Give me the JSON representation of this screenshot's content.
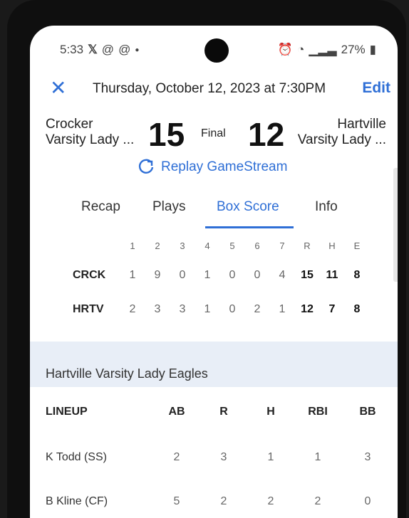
{
  "status_bar": {
    "time": "5:33",
    "left_icons": [
      "x-logo-icon",
      "threads-icon",
      "threads-icon",
      "dot-icon"
    ],
    "battery": "27%"
  },
  "header": {
    "close_label": "✕",
    "date": "Thursday, October 12, 2023 at 7:30PM",
    "edit_label": "Edit"
  },
  "game": {
    "home_team_line1": "Crocker",
    "home_team_line2": "Varsity Lady ...",
    "home_score": "15",
    "status": "Final",
    "away_score": "12",
    "away_team_line1": "Hartville",
    "away_team_line2": "Varsity Lady ...",
    "replay_label": "Replay GameStream"
  },
  "tabs": [
    {
      "label": "Recap",
      "active": false
    },
    {
      "label": "Plays",
      "active": false
    },
    {
      "label": "Box Score",
      "active": true
    },
    {
      "label": "Info",
      "active": false
    }
  ],
  "linescore": {
    "headers": [
      "1",
      "2",
      "3",
      "4",
      "5",
      "6",
      "7",
      "R",
      "H",
      "E"
    ],
    "rows": [
      {
        "team": "CRCK",
        "innings": [
          "1",
          "9",
          "0",
          "1",
          "0",
          "0",
          "4"
        ],
        "R": "15",
        "H": "11",
        "E": "8"
      },
      {
        "team": "HRTV",
        "innings": [
          "2",
          "3",
          "3",
          "1",
          "0",
          "2",
          "1"
        ],
        "R": "12",
        "H": "7",
        "E": "8"
      }
    ]
  },
  "section_title": "Hartville Varsity Lady Eagles",
  "lineup": {
    "headers": [
      "LINEUP",
      "AB",
      "R",
      "H",
      "RBI",
      "BB"
    ],
    "players": [
      {
        "name": "K Todd (SS)",
        "AB": "2",
        "R": "3",
        "H": "1",
        "RBI": "1",
        "BB": "3"
      },
      {
        "name": "B Kline (CF)",
        "AB": "5",
        "R": "2",
        "H": "2",
        "RBI": "2",
        "BB": "0"
      }
    ]
  },
  "colors": {
    "accent": "#2f6fd6",
    "section_bg": "#e8eef7"
  }
}
